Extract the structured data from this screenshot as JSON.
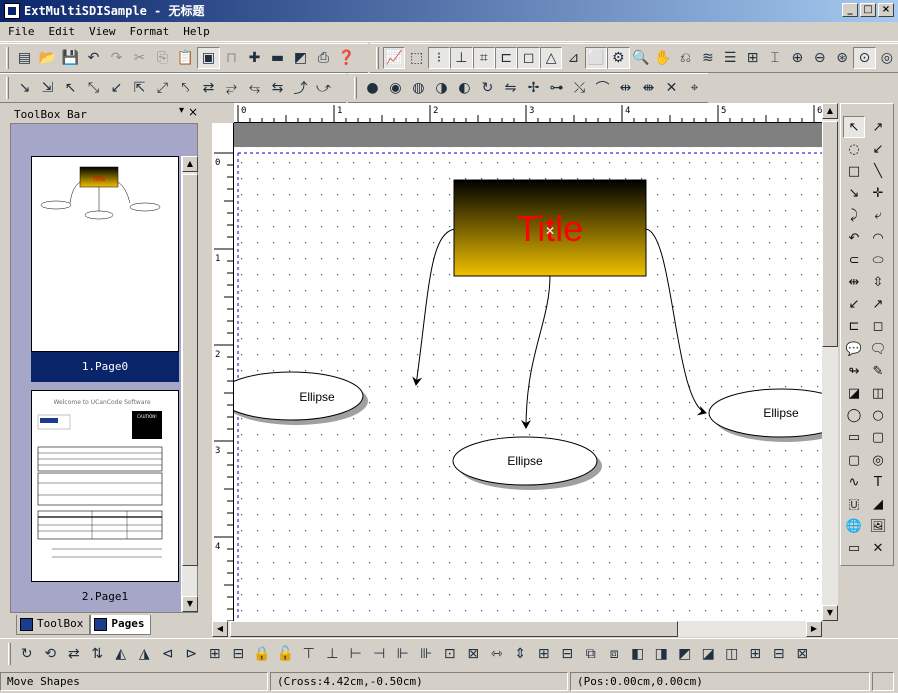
{
  "window": {
    "title": "ExtMultiSDISample - 无标题"
  },
  "title_buttons": [
    "_",
    "□",
    "×"
  ],
  "menu": [
    "File",
    "Edit",
    "View",
    "Format",
    "Help"
  ],
  "toolbar1": [
    {
      "icon": "new-icon",
      "g": "▤"
    },
    {
      "icon": "open-icon",
      "g": "📂"
    },
    {
      "icon": "save-icon",
      "g": "💾"
    },
    {
      "icon": "undo-icon",
      "g": "↶"
    },
    {
      "icon": "redo-icon",
      "g": "↷",
      "gray": true
    },
    {
      "icon": "cut-icon",
      "g": "✂",
      "gray": true
    },
    {
      "icon": "copy-icon",
      "g": "⎘",
      "gray": true
    },
    {
      "icon": "paste-icon",
      "g": "📋"
    },
    {
      "icon": "page-icon",
      "g": "▣",
      "pressed": true
    },
    {
      "icon": "ruler-icon",
      "g": "⊓",
      "gray": true
    },
    {
      "icon": "zoom-plus-icon",
      "g": "✚"
    },
    {
      "icon": "zoom-minus-icon",
      "g": "▬"
    },
    {
      "icon": "layer-icon",
      "g": "◩"
    },
    {
      "icon": "print-icon",
      "g": "⎙"
    },
    {
      "icon": "help-icon",
      "g": "❓"
    }
  ],
  "toolbar2": [
    {
      "icon": "chart-icon",
      "g": "📈",
      "pressed": true
    },
    {
      "icon": "select-icon",
      "g": "⬚"
    },
    {
      "icon": "grid-icon",
      "g": "⁝",
      "pressed": true
    },
    {
      "icon": "snap-icon",
      "g": "⊥",
      "pressed": true
    },
    {
      "icon": "crosshair-icon",
      "g": "⌗",
      "pressed": true
    },
    {
      "icon": "margin-icon",
      "g": "⊏",
      "pressed": true
    },
    {
      "icon": "bounds-icon",
      "g": "◻",
      "pressed": true
    },
    {
      "icon": "triangle-icon",
      "g": "△",
      "pressed": true
    },
    {
      "icon": "handle-icon",
      "g": "⊿"
    },
    {
      "icon": "frame-icon",
      "g": "⬜",
      "pressed": true
    },
    {
      "icon": "gear-icon",
      "g": "⚙",
      "pressed": true
    },
    {
      "icon": "zoom-icon",
      "g": "🔍"
    },
    {
      "icon": "hand-icon",
      "g": "✋"
    },
    {
      "icon": "stamp-icon",
      "g": "⎌"
    },
    {
      "icon": "layers-icon",
      "g": "≋"
    },
    {
      "icon": "layers2-icon",
      "g": "☰"
    },
    {
      "icon": "align-icon",
      "g": "⊞"
    },
    {
      "icon": "center-icon",
      "g": "⌶"
    },
    {
      "icon": "zoom-in-icon",
      "g": "⊕"
    },
    {
      "icon": "zoom-out-icon",
      "g": "⊖"
    },
    {
      "icon": "zoom-fit-icon",
      "g": "⊛"
    },
    {
      "icon": "zoom-select-icon",
      "g": "⊙",
      "pressed": true
    },
    {
      "icon": "zoom-all-icon",
      "g": "◎"
    }
  ],
  "toolbar3": [
    {
      "icon": "link1-icon",
      "g": "↘"
    },
    {
      "icon": "link2-icon",
      "g": "⇲"
    },
    {
      "icon": "link3-icon",
      "g": "↖"
    },
    {
      "icon": "link4-icon",
      "g": "⤡"
    },
    {
      "icon": "link5-icon",
      "g": "↙"
    },
    {
      "icon": "link6-icon",
      "g": "⇱"
    },
    {
      "icon": "link7-icon",
      "g": "⤢"
    },
    {
      "icon": "link8-icon",
      "g": "⤣"
    },
    {
      "icon": "link9-icon",
      "g": "⇄"
    },
    {
      "icon": "link10-icon",
      "g": "⥂"
    },
    {
      "icon": "link11-icon",
      "g": "⥃"
    },
    {
      "icon": "link12-icon",
      "g": "⇆"
    },
    {
      "icon": "link13-icon",
      "g": "⤴"
    },
    {
      "icon": "link14-icon",
      "g": "⤻"
    }
  ],
  "toolbar4": [
    {
      "icon": "union-icon",
      "g": "●"
    },
    {
      "icon": "combine-icon",
      "g": "◉"
    },
    {
      "icon": "intersect-icon",
      "g": "◍"
    },
    {
      "icon": "subtract-icon",
      "g": "◑"
    },
    {
      "icon": "exclude-icon",
      "g": "◐"
    },
    {
      "icon": "rotate-icon",
      "g": "↻"
    },
    {
      "icon": "flip-icon",
      "g": "⇋"
    },
    {
      "icon": "node-icon",
      "g": "✢"
    },
    {
      "icon": "node2-icon",
      "g": "⊶"
    },
    {
      "icon": "bezier-icon",
      "g": "⤯"
    },
    {
      "icon": "arc-icon",
      "g": "⌒"
    },
    {
      "icon": "spacing-icon",
      "g": "⇹"
    },
    {
      "icon": "spacing2-icon",
      "g": "⇼"
    },
    {
      "icon": "tools-icon",
      "g": "✕"
    },
    {
      "icon": "cursor-icon",
      "g": "⌖"
    }
  ],
  "toolbox": {
    "title": "ToolBox Bar",
    "pin": "▾",
    "close": "×"
  },
  "pages": [
    {
      "label": "1.Page0",
      "thumb_title": "Title"
    },
    {
      "label": "2.Page1",
      "heading": "Welcome to UCanCode Software",
      "badge": "CAUTION!"
    }
  ],
  "panel_tabs": [
    {
      "label": "ToolBox",
      "active": false
    },
    {
      "label": "Pages",
      "active": true
    }
  ],
  "ruler_top": [
    "0",
    "1",
    "2",
    "3",
    "4",
    "5",
    "6"
  ],
  "ruler_left": [
    "0",
    "1",
    "2",
    "3",
    "4"
  ],
  "diagram": {
    "title_box": {
      "text": "Title",
      "text_color": "#ff0000",
      "top_color": "#000000",
      "bottom_color": "#f0c000"
    },
    "ellipses": [
      {
        "text": "Ellipse"
      },
      {
        "text": "Ellipse"
      },
      {
        "text": "Ellipse"
      }
    ]
  },
  "right_tools": [
    "↖",
    "↗",
    "◌",
    "↙",
    "□",
    "╲",
    "↘",
    "✛",
    "⤸",
    "⤶",
    "↶",
    "◠",
    "⊂",
    "⬭",
    "⇹",
    "⇳",
    "↙",
    "↗",
    "⊏",
    "◻",
    "💬",
    "🗨",
    "↬",
    "✎",
    "◪",
    "◫",
    "◯",
    "○",
    "▭",
    "▢",
    "▢",
    "◎",
    "∿",
    "T",
    "🇺",
    "◢",
    "🌐",
    "🖼",
    "▭",
    "✕"
  ],
  "bottom_tools": [
    "↻",
    "⟲",
    "⇄",
    "⇅",
    "◭",
    "◮",
    "⊲",
    "⊳",
    "⊞",
    "⊟",
    "🔒",
    "🔓",
    "⊤",
    "⊥",
    "⊢",
    "⊣",
    "⊩",
    "⊪",
    "⊡",
    "⊠",
    "⇿",
    "⇕",
    "⊞",
    "⊟",
    "⧉",
    "⧈",
    "◧",
    "◨",
    "◩",
    "◪",
    "◫",
    "⊞",
    "⊟",
    "⊠"
  ],
  "status": {
    "message": "Move Shapes",
    "cross": "(Cross:4.42cm,-0.50cm)",
    "pos": "(Pos:0.00cm,0.00cm)"
  }
}
